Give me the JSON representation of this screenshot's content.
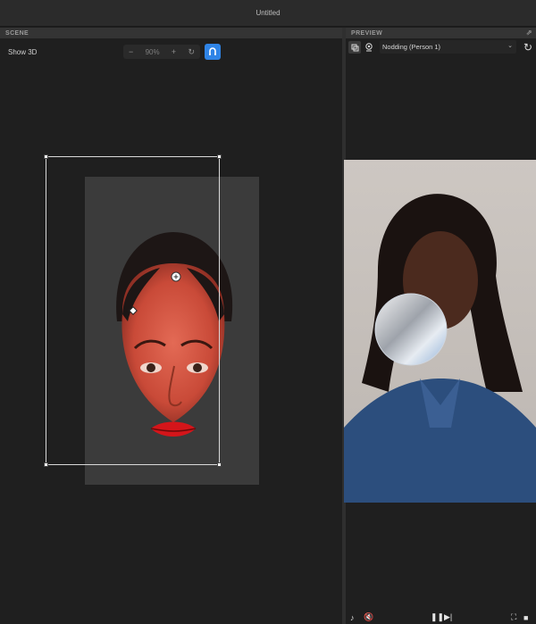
{
  "window": {
    "title": "Untitled"
  },
  "scene": {
    "header": "SCENE",
    "show3d_label": "Show 3D",
    "zoom": {
      "minus": "−",
      "value": "90%",
      "plus": "+",
      "reset": "↻"
    }
  },
  "preview": {
    "header": "PREVIEW",
    "dropdown": {
      "selected": "Nodding (Person 1)"
    },
    "refresh": "↻"
  },
  "colors": {
    "accent": "#2f84e6",
    "panel": "#1f1f1f",
    "canvas": "#3b3b3b"
  }
}
